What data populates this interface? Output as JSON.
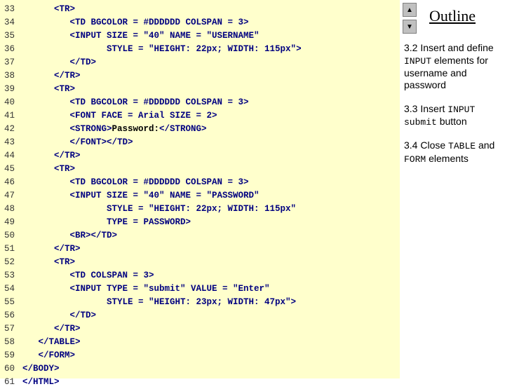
{
  "code": {
    "lines": [
      {
        "n": "33",
        "t": "      <TR>"
      },
      {
        "n": "34",
        "t": "         <TD BGCOLOR = #DDDDDD COLSPAN = 3>"
      },
      {
        "n": "35",
        "t": "         <INPUT SIZE = \"40\" NAME = \"USERNAME\""
      },
      {
        "n": "36",
        "t": "                STYLE = \"HEIGHT: 22px; WIDTH: 115px\">"
      },
      {
        "n": "37",
        "t": "         </TD>"
      },
      {
        "n": "38",
        "t": "      </TR>"
      },
      {
        "n": "39",
        "t": "      <TR>"
      },
      {
        "n": "40",
        "t": "         <TD BGCOLOR = #DDDDDD COLSPAN = 3>"
      },
      {
        "n": "41",
        "t": "         <FONT FACE = Arial SIZE = 2>"
      },
      {
        "n": "42",
        "t": "         <STRONG>Password:</STRONG>"
      },
      {
        "n": "43",
        "t": "         </FONT></TD>"
      },
      {
        "n": "44",
        "t": "      </TR>"
      },
      {
        "n": "45",
        "t": "      <TR>"
      },
      {
        "n": "46",
        "t": "         <TD BGCOLOR = #DDDDDD COLSPAN = 3>"
      },
      {
        "n": "47",
        "t": "         <INPUT SIZE = \"40\" NAME = \"PASSWORD\""
      },
      {
        "n": "48",
        "t": "                STYLE = \"HEIGHT: 22px; WIDTH: 115px\""
      },
      {
        "n": "49",
        "t": "                TYPE = PASSWORD>"
      },
      {
        "n": "50",
        "t": "         <BR></TD>"
      },
      {
        "n": "51",
        "t": "      </TR>"
      },
      {
        "n": "52",
        "t": "      <TR>"
      },
      {
        "n": "53",
        "t": "         <TD COLSPAN = 3>"
      },
      {
        "n": "54",
        "t": "         <INPUT TYPE = \"submit\" VALUE = \"Enter\""
      },
      {
        "n": "55",
        "t": "                STYLE = \"HEIGHT: 23px; WIDTH: 47px\">"
      },
      {
        "n": "56",
        "t": "         </TD>"
      },
      {
        "n": "57",
        "t": "      </TR>"
      },
      {
        "n": "58",
        "t": "   </TABLE>"
      },
      {
        "n": "59",
        "t": "   </FORM>"
      },
      {
        "n": "60",
        "t": "</BODY>"
      },
      {
        "n": "61",
        "t": "</HTML>"
      }
    ]
  },
  "outline": {
    "title": "Outline",
    "items": [
      {
        "num": "3.2",
        "pre": "Insert and define ",
        "code": "INPUT",
        "post": " elements for username and password"
      },
      {
        "num": "3.3",
        "pre": "Insert ",
        "code": "INPUT submit",
        "post": " button"
      },
      {
        "num": "3.4",
        "pre": "Close ",
        "code": "TABLE",
        "mid": " and ",
        "code2": "FORM",
        "post": " elements"
      }
    ],
    "nav": {
      "up": "▲",
      "down": "▼"
    }
  }
}
